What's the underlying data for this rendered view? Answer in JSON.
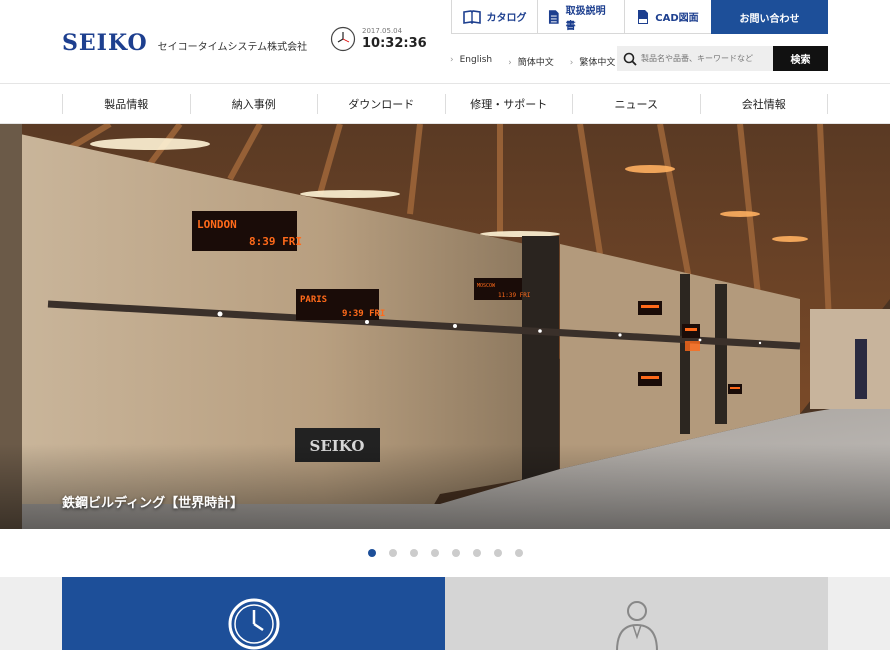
{
  "brand": {
    "logo_text": "SEIKO",
    "company": "セイコータイムシステム株式会社"
  },
  "clock": {
    "date": "2017.05.04",
    "time": "10:32:36"
  },
  "utility_nav": [
    {
      "label": "カタログ",
      "icon": "catalog-book-icon"
    },
    {
      "label": "取扱説明書",
      "icon": "manual-document-icon"
    },
    {
      "label": "CAD図面",
      "icon": "cad-document-icon"
    },
    {
      "label": "お問い合わせ"
    }
  ],
  "languages": [
    "English",
    "簡体中文",
    "繁体中文"
  ],
  "search": {
    "placeholder": "製品名や品番、キーワードなど",
    "button": "検索"
  },
  "main_nav": [
    "製品情報",
    "納入事例",
    "ダウンロード",
    "修理・サポート",
    "ニュース",
    "会社情報"
  ],
  "hero": {
    "caption": "鉄鋼ビルディング【世界時計】",
    "signs": [
      {
        "city": "LONDON",
        "time": "8:39 FRI"
      },
      {
        "city": "PARIS",
        "time": "9:39 FRI"
      },
      {
        "city": "MOSCOW",
        "time": "11:39 FRI"
      }
    ],
    "wall_logo": "SEIKO"
  },
  "carousel": {
    "count": 8,
    "active": 0
  },
  "colors": {
    "brand_blue": "#1d4f99",
    "logo_blue": "#1d3f8f",
    "led_orange": "#ff6a1a"
  }
}
